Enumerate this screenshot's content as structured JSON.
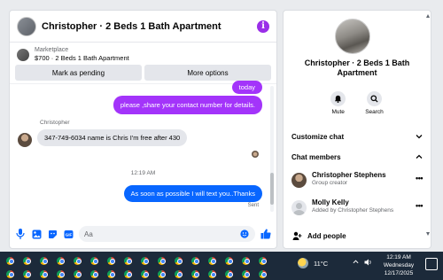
{
  "chat": {
    "title": "Christopher · 2 Beds 1 Bath Apartment",
    "marketplace_label": "Marketplace",
    "listing_price": "$700 · 2 Beds 1 Bath Apartment",
    "mark_pending_label": "Mark as pending",
    "more_options_label": "More options",
    "messages": {
      "today": "today",
      "please": "please ,share your contact  number for details.",
      "sender_name": "Christopher",
      "reply": "347-749-6034 name is Chris I'm free after 430",
      "timestamp": "12:19 AM",
      "latest": "As soon as possible I will text you..Thanks",
      "sent_status": "Sent"
    },
    "composer": {
      "placeholder": "Aa"
    }
  },
  "info": {
    "title": "Christopher · 2 Beds 1 Bath Apartment",
    "mute_label": "Mute",
    "search_label": "Search",
    "customize_label": "Customize chat",
    "members_label": "Chat members",
    "members": [
      {
        "name": "Christopher Stephens",
        "role": "Group creator"
      },
      {
        "name": "Molly Kelly",
        "role": "Added by Christopher Stephens"
      }
    ],
    "add_people_label": "Add people"
  },
  "taskbar": {
    "temperature": "11°C",
    "time": "12:19 AM",
    "day": "Wednesday",
    "date": "12/17/2025"
  },
  "colors": {
    "purple_bubble": "#a334fa",
    "blue_bubble": "#0866ff",
    "accent": "#0866ff"
  }
}
